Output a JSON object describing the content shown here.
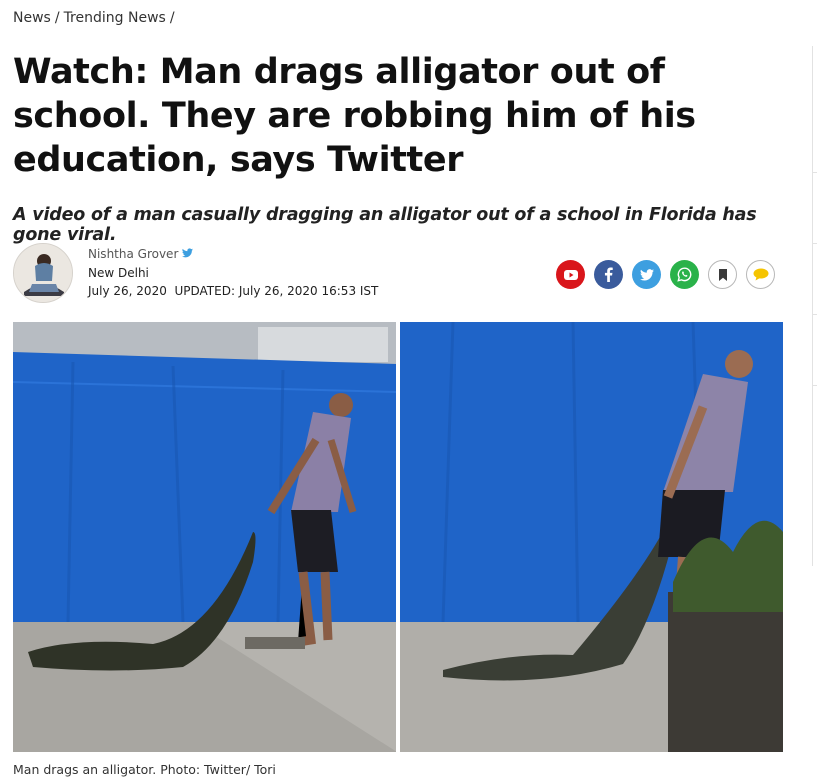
{
  "breadcrumb": {
    "items": [
      "News",
      "Trending News"
    ],
    "separator": "/"
  },
  "article": {
    "headline": "Watch: Man drags alligator out of school. They are robbing him of his education, says Twitter",
    "summary": "A video of a man casually dragging an alligator out of a school in Florida has gone viral.",
    "author": {
      "name": "Nishtha Grover",
      "location": "New Delhi",
      "published": "July 26, 2020",
      "updated_label": "UPDATED:",
      "updated": "July 26, 2020 16:53 IST",
      "verified_icon": "twitter-bird-icon"
    },
    "share_icons": [
      "youtube-icon",
      "facebook-icon",
      "twitter-icon",
      "whatsapp-icon",
      "bookmark-icon",
      "comment-icon"
    ],
    "image_caption": "Man drags an alligator. Photo: Twitter/ Tori"
  },
  "colors": {
    "youtube": "#d9161b",
    "facebook": "#3a5b9c",
    "twitter": "#3d9fe0",
    "whatsapp": "#2ab24a",
    "comment": "#f5c400",
    "tarp_blue": "#1f64c8"
  }
}
